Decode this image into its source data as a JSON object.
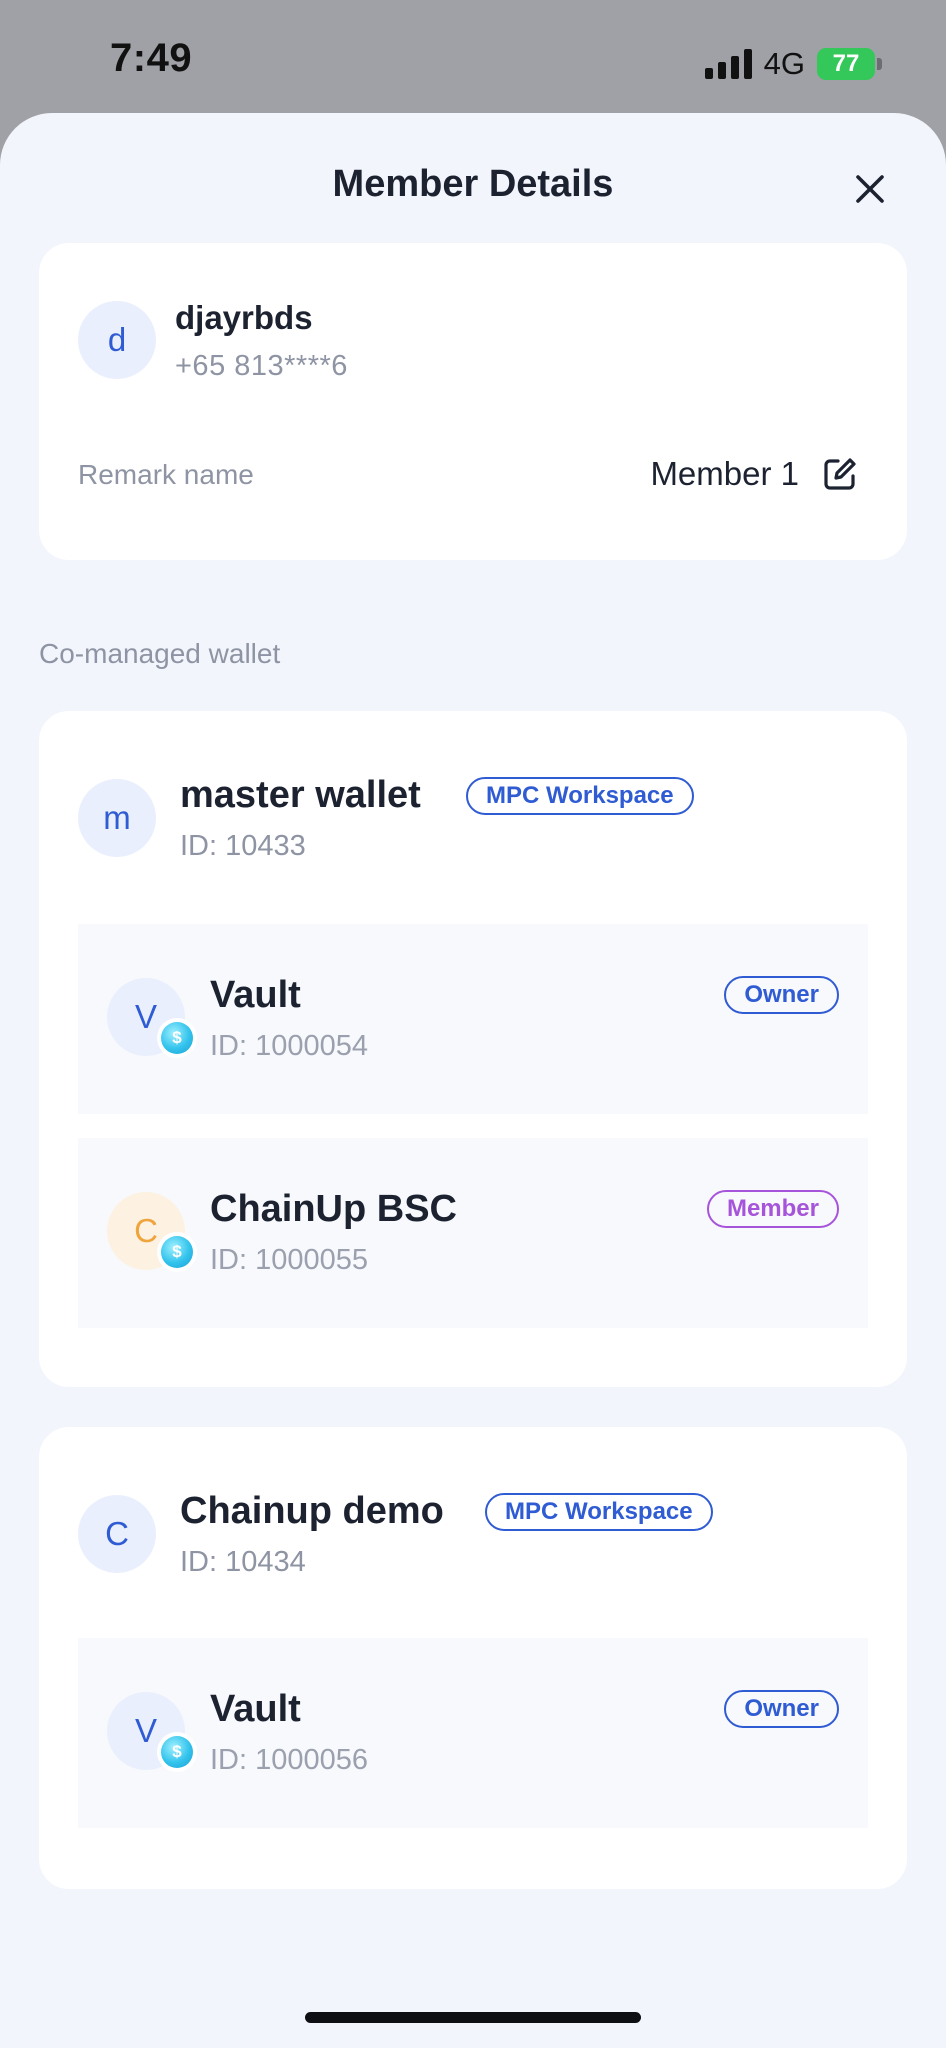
{
  "status_bar": {
    "time": "7:49",
    "network": "4G",
    "battery": "77"
  },
  "sheet": {
    "title": "Member Details"
  },
  "member": {
    "avatar_letter": "d",
    "name": "djayrbds",
    "phone": "+65 813****6",
    "remark_label": "Remark name",
    "remark_value": "Member 1"
  },
  "section_label": "Co-managed wallet",
  "wallets": [
    {
      "avatar_letter": "m",
      "name": "master wallet",
      "tag": "MPC Workspace",
      "id": "ID: 10433",
      "vaults": [
        {
          "avatar_letter": "V",
          "name": "Vault",
          "id": "ID: 1000054",
          "role": "Owner",
          "role_color": "#2f5bd3"
        },
        {
          "avatar_letter": "C",
          "name": "ChainUp BSC",
          "id": "ID: 1000055",
          "role": "Member",
          "role_color": "#a655db"
        }
      ]
    },
    {
      "avatar_letter": "C",
      "name": "Chainup demo",
      "tag": "MPC Workspace",
      "id": "ID: 10434",
      "vaults": [
        {
          "avatar_letter": "V",
          "name": "Vault",
          "id": "ID: 1000056",
          "role": "Owner",
          "role_color": "#2f5bd3"
        }
      ]
    }
  ],
  "icons": {
    "close": "close-icon",
    "edit": "edit-icon",
    "coin": "coin-icon"
  },
  "colors": {
    "accent": "#2f5bd3",
    "member_tag": "#a655db",
    "sheet_bg": "#f2f5fc"
  }
}
